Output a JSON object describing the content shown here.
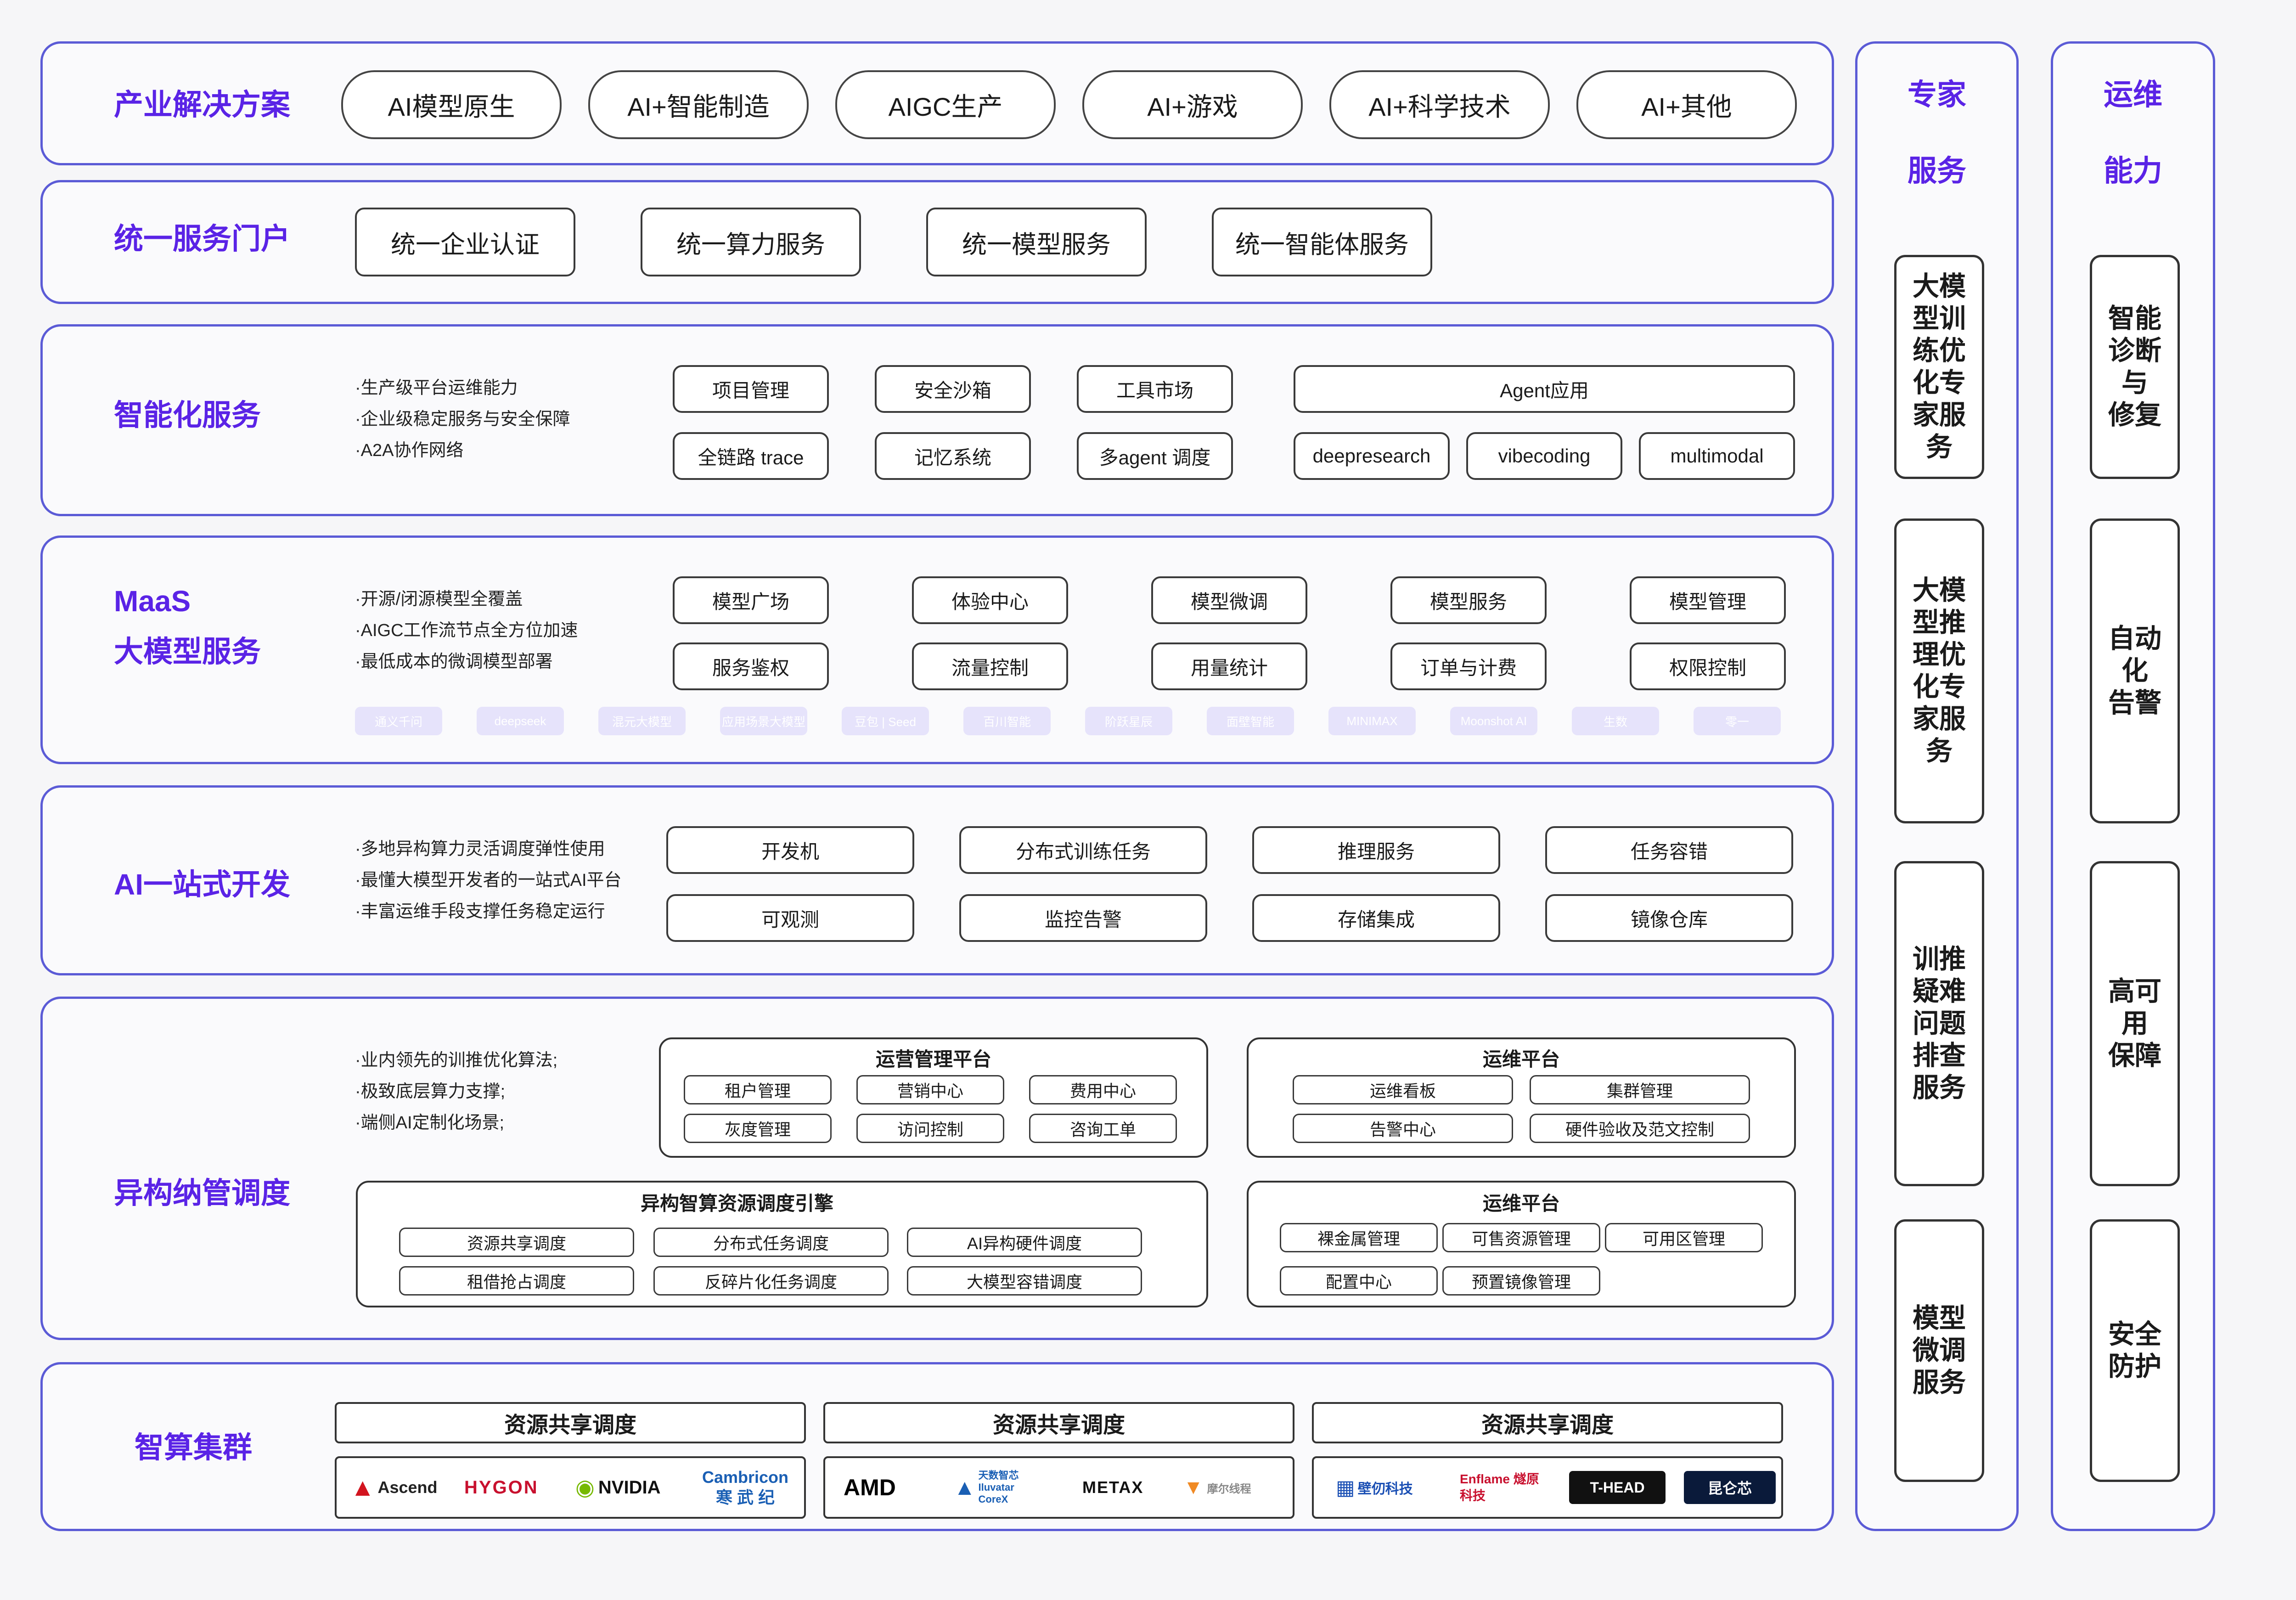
{
  "industry": {
    "label": "产业解决方案",
    "items": [
      "AI模型原生",
      "AI+智能制造",
      "AIGC生产",
      "AI+游戏",
      "AI+科学技术",
      "AI+其他"
    ]
  },
  "portal": {
    "label": "统一服务门户",
    "items": [
      "统一企业认证",
      "统一算力服务",
      "统一模型服务",
      "统一智能体服务"
    ]
  },
  "intelligent": {
    "label": "智能化服务",
    "bullets": [
      "·生产级平台运维能力",
      "·企业级稳定服务与安全保障",
      "·A2A协作网络"
    ],
    "items": [
      "项目管理",
      "安全沙箱",
      "工具市场",
      "全链路 trace",
      "记忆系统",
      "多agent 调度"
    ],
    "agent": {
      "title": "Agent应用",
      "items": [
        "deepresearch",
        "vibecoding",
        "multimodal"
      ]
    }
  },
  "maas": {
    "label1": "MaaS",
    "label2": "大模型服务",
    "bullets": [
      "·开源/闭源模型全覆盖",
      "·AIGC工作流节点全方位加速",
      "·最低成本的微调模型部署"
    ],
    "items": [
      "模型广场",
      "体验中心",
      "模型微调",
      "模型服务",
      "模型管理",
      "服务鉴权",
      "流量控制",
      "用量统计",
      "订单与计费",
      "权限控制"
    ],
    "logos": [
      "通义千问",
      "deepseek",
      "混元大模型",
      "应用场景大模型",
      "豆包 | Seed",
      "百川智能",
      "阶跃星辰",
      "面壁智能",
      "MINIMAX",
      "Moonshot AI",
      "生数",
      "零一"
    ]
  },
  "aidev": {
    "label": "AI一站式开发",
    "bullets": [
      "·多地异构算力灵活调度弹性使用",
      "·最懂大模型开发者的一站式AI平台",
      "·丰富运维手段支撑任务稳定运行"
    ],
    "items": [
      "开发机",
      "分布式训练任务",
      "推理服务",
      "任务容错",
      "可观测",
      "监控告警",
      "存储集成",
      "镜像仓库"
    ]
  },
  "hetero": {
    "label": "异构纳管调度",
    "bullets": [
      "·业内领先的训推优化算法;",
      "·极致底层算力支撑;",
      "·端侧AI定制化场景;"
    ],
    "ops_mgmt": {
      "title": "运营管理平台",
      "items": [
        "租户管理",
        "营销中心",
        "费用中心",
        "灰度管理",
        "访问控制",
        "咨询工单"
      ]
    },
    "om1": {
      "title": "运维平台",
      "items": [
        "运维看板",
        "集群管理",
        "告警中心",
        "硬件验收及范文控制"
      ]
    },
    "engine": {
      "title": "异构智算资源调度引擎",
      "items": [
        "资源共享调度",
        "分布式任务调度",
        "AI异构硬件调度",
        "租借抢占调度",
        "反碎片化任务调度",
        "大模型容错调度"
      ]
    },
    "om2": {
      "title": "运维平台",
      "items": [
        "裸金属管理",
        "可售资源管理",
        "可用区管理",
        "配置中心",
        "预置镜像管理"
      ]
    }
  },
  "cluster": {
    "label": "智算集群",
    "groups": [
      {
        "title": "资源共享调度",
        "vendors": [
          "Ascend",
          "HYGON",
          "NVIDIA",
          "Cambricon 寒 武 纪"
        ]
      },
      {
        "title": "资源共享调度",
        "vendors": [
          "AMD",
          "天数智芯 Iluvatar CoreX",
          "METAX",
          "摩尔线程"
        ]
      },
      {
        "title": "资源共享调度",
        "vendors": [
          "壁仞科技",
          "Enflame 燧原科技",
          "T-HEAD",
          "昆仑芯"
        ]
      }
    ]
  },
  "expert": {
    "title1": "专家",
    "title2": "服务",
    "items": [
      "大模\n型训\n练优\n化专\n家服\n务",
      "大模\n型推\n理优\n化专\n家服\n务",
      "训推\n疑难\n问题\n排查\n服务",
      "模型\n微调\n服务"
    ]
  },
  "ops": {
    "title1": "运维",
    "title2": "能力",
    "items": [
      "智能\n诊断\n与\n修复",
      "自动化\n告警",
      "高可用\n保障",
      "安全\n防护"
    ]
  },
  "colors": {
    "accent": "#5a23e6",
    "border": "#5b5bd6",
    "logo_bg": "#e6e3fb"
  }
}
